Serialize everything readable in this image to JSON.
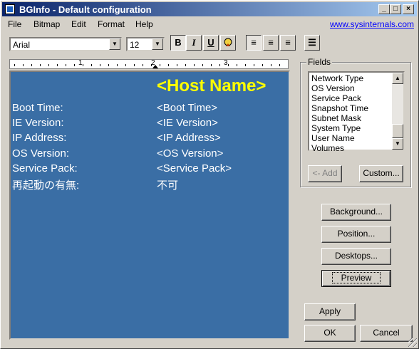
{
  "title": "BGInfo - Default configuration",
  "window_controls": {
    "minimize": "_",
    "maximize": "□",
    "close": "×"
  },
  "menu": {
    "file": "File",
    "bitmap": "Bitmap",
    "edit": "Edit",
    "format": "Format",
    "help": "Help"
  },
  "link": "www.sysinternals.com",
  "toolbar": {
    "font": "Arial",
    "size": "12",
    "bold": "B",
    "italic": "I",
    "underline": "U",
    "align_left": "≡",
    "align_center": "≡",
    "align_right": "≡",
    "bullets": "☰"
  },
  "ruler": {
    "marks": [
      "1",
      "2",
      "3"
    ]
  },
  "editor": {
    "host": "<Host Name>",
    "rows": [
      {
        "label": "Boot Time:",
        "value": "<Boot Time>"
      },
      {
        "label": "IE Version:",
        "value": "<IE Version>"
      },
      {
        "label": "IP Address:",
        "value": "<IP Address>"
      },
      {
        "label": "OS Version:",
        "value": "<OS Version>"
      },
      {
        "label": "Service Pack:",
        "value": "<Service Pack>"
      },
      {
        "label": "再起動の有無:",
        "value": "不可"
      }
    ]
  },
  "fields": {
    "label": "Fields",
    "items": [
      "Network Type",
      "OS Version",
      "Service Pack",
      "Snapshot Time",
      "Subnet Mask",
      "System Type",
      "User Name",
      "Volumes"
    ],
    "add": "<- Add",
    "custom": "Custom..."
  },
  "buttons": {
    "background": "Background...",
    "position": "Position...",
    "desktops": "Desktops...",
    "preview": "Preview",
    "apply": "Apply",
    "ok": "OK",
    "cancel": "Cancel"
  },
  "colors": {
    "editor_bg": "#3a6ea5",
    "host": "#ffff00",
    "title_start": "#0a246a"
  }
}
